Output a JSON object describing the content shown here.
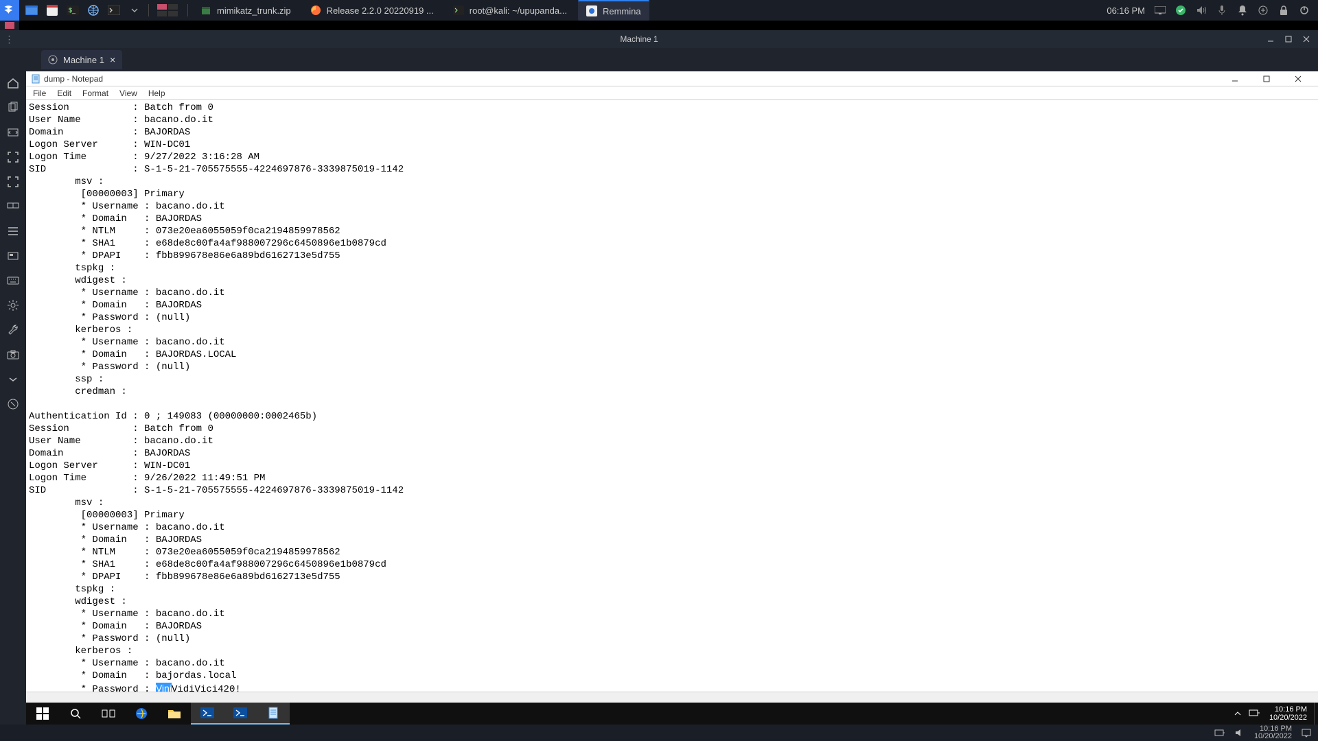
{
  "kali": {
    "tasks": [
      {
        "icon": "archive",
        "label": "mimikatz_trunk.zip"
      },
      {
        "icon": "firefox",
        "label": "Release 2.2.0 20220919 ..."
      },
      {
        "icon": "terminal",
        "label": "root@kali: ~/upupanda..."
      },
      {
        "icon": "remmina",
        "label": "Remmina",
        "active": true
      }
    ],
    "clock": "06:16 PM"
  },
  "remmina": {
    "title": "Machine 1",
    "tab": "Machine 1"
  },
  "notepad": {
    "title": "dump - Notepad",
    "menu": [
      "File",
      "Edit",
      "Format",
      "View",
      "Help"
    ],
    "highlight": "Vini",
    "afterHighlight": "VidiVici420!",
    "lines": [
      "Session           : Batch from 0",
      "User Name         : bacano.do.it",
      "Domain            : BAJORDAS",
      "Logon Server      : WIN-DC01",
      "Logon Time        : 9/27/2022 3:16:28 AM",
      "SID               : S-1-5-21-705575555-4224697876-3339875019-1142",
      "        msv :",
      "         [00000003] Primary",
      "         * Username : bacano.do.it",
      "         * Domain   : BAJORDAS",
      "         * NTLM     : 073e20ea6055059f0ca2194859978562",
      "         * SHA1     : e68de8c00fa4af988007296c6450896e1b0879cd",
      "         * DPAPI    : fbb899678e86e6a89bd6162713e5d755",
      "        tspkg :",
      "        wdigest :",
      "         * Username : bacano.do.it",
      "         * Domain   : BAJORDAS",
      "         * Password : (null)",
      "        kerberos :",
      "         * Username : bacano.do.it",
      "         * Domain   : BAJORDAS.LOCAL",
      "         * Password : (null)",
      "        ssp :",
      "        credman :",
      "",
      "Authentication Id : 0 ; 149083 (00000000:0002465b)",
      "Session           : Batch from 0",
      "User Name         : bacano.do.it",
      "Domain            : BAJORDAS",
      "Logon Server      : WIN-DC01",
      "Logon Time        : 9/26/2022 11:49:51 PM",
      "SID               : S-1-5-21-705575555-4224697876-3339875019-1142",
      "        msv :",
      "         [00000003] Primary",
      "         * Username : bacano.do.it",
      "         * Domain   : BAJORDAS",
      "         * NTLM     : 073e20ea6055059f0ca2194859978562",
      "         * SHA1     : e68de8c00fa4af988007296c6450896e1b0879cd",
      "         * DPAPI    : fbb899678e86e6a89bd6162713e5d755",
      "        tspkg :",
      "        wdigest :",
      "         * Username : bacano.do.it",
      "         * Domain   : BAJORDAS",
      "         * Password : (null)",
      "        kerberos :",
      "         * Username : bacano.do.it",
      "         * Domain   : bajordas.local"
    ],
    "lastLinePrefix": "         * Password : "
  },
  "win": {
    "time": "10:16 PM",
    "date": "10/20/2022"
  },
  "host": {
    "time": "10:16 PM",
    "date": "10/20/2022"
  }
}
